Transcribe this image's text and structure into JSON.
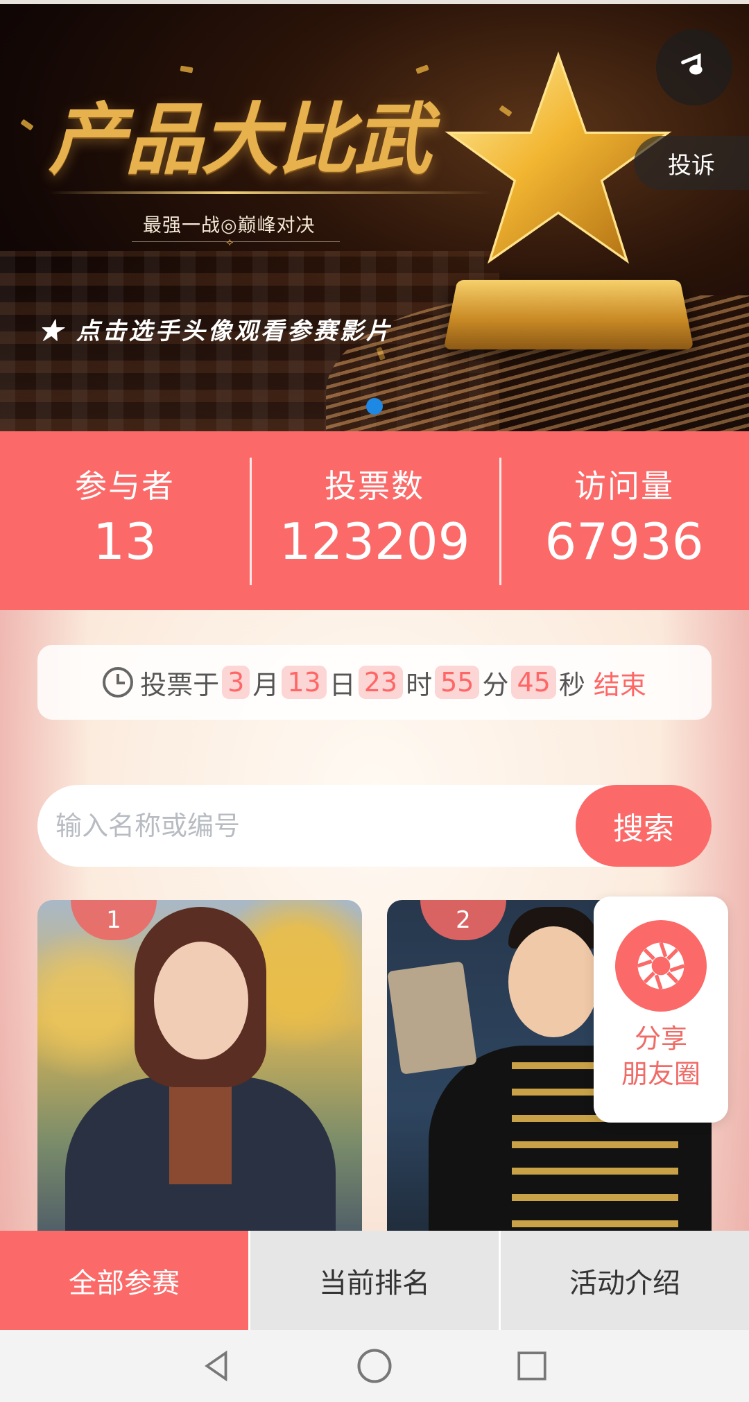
{
  "banner": {
    "title": "产品大比武",
    "subtitle": "最强一战◎巅峰对决",
    "hint": "★ 点击选手头像观看参赛影片",
    "complain_label": "投诉",
    "music_icon": "music-note-icon"
  },
  "stats": [
    {
      "label": "参与者",
      "value": "13"
    },
    {
      "label": "投票数",
      "value": "123209"
    },
    {
      "label": "访问量",
      "value": "67936"
    }
  ],
  "countdown": {
    "prefix": "投票于",
    "month": "3",
    "month_unit": "月",
    "day": "13",
    "day_unit": "日",
    "hour": "23",
    "hour_unit": "时",
    "minute": "55",
    "minute_unit": "分",
    "second": "45",
    "second_unit": "秒",
    "suffix": "结束"
  },
  "search": {
    "placeholder": "输入名称或编号",
    "button_label": "搜索"
  },
  "contestants": [
    {
      "number": "1"
    },
    {
      "number": "2"
    }
  ],
  "share": {
    "label_line1": "分享",
    "label_line2": "朋友圈",
    "icon": "camera-aperture-icon"
  },
  "bottom_nav": [
    {
      "label": "全部参赛",
      "active": true
    },
    {
      "label": "当前排名",
      "active": false
    },
    {
      "label": "活动介绍",
      "active": false
    }
  ],
  "colors": {
    "accent": "#fb6a68",
    "highlight_text": "#ff6666",
    "carousel_dot": "#1e88e5"
  }
}
